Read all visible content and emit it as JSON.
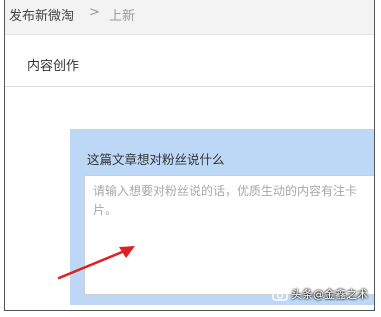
{
  "breadcrumb": {
    "parent": "发布新微淘",
    "separator": ">",
    "current": "上新"
  },
  "section": {
    "title": "内容创作"
  },
  "post_panel": {
    "label": "这篇文章想对粉丝说什么",
    "placeholder": "请输入想要对粉丝说的话，优质生动的内容有注卡片。"
  },
  "watermark": {
    "text": "头条@金鑫之术",
    "icon": "camera-icon"
  },
  "colors": {
    "panel": "#bcd8f6",
    "annotation_arrow": "#e02020"
  }
}
